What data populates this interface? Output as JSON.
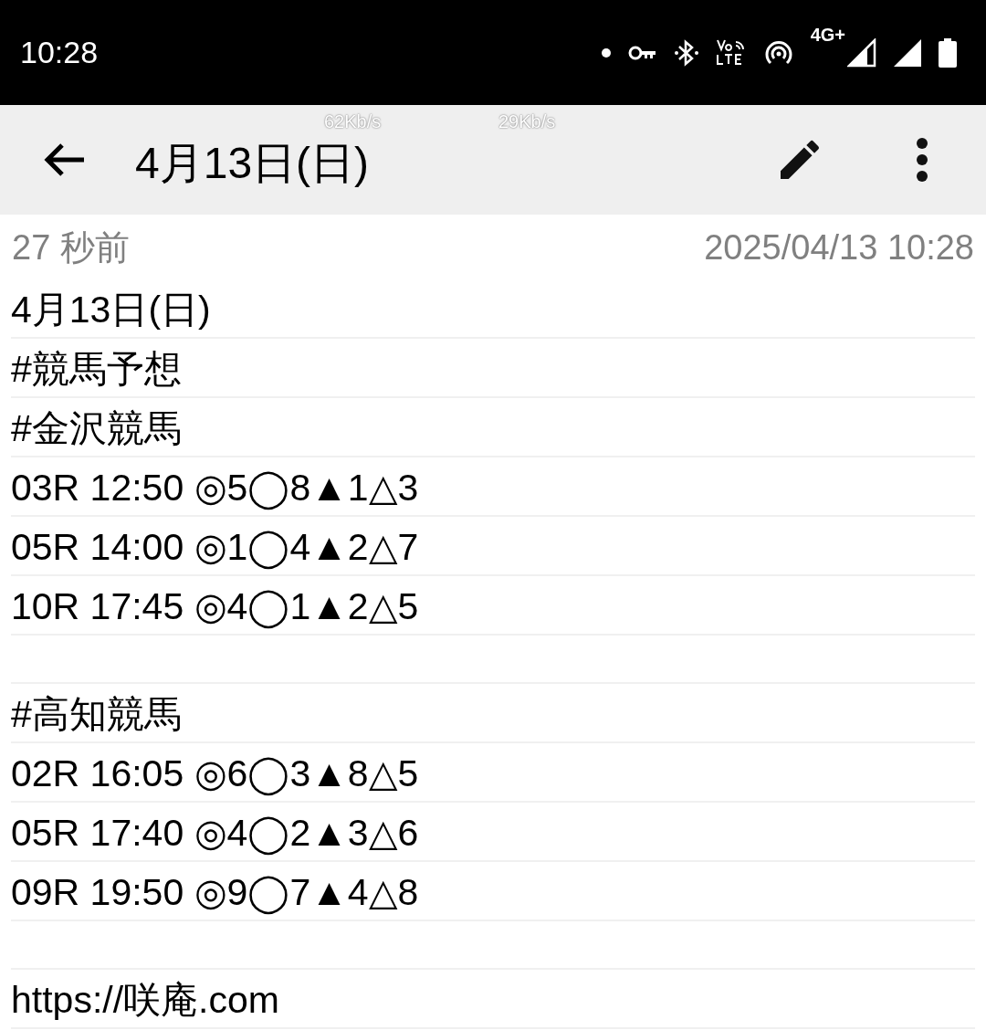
{
  "status_bar": {
    "time": "10:28",
    "network": "4G+"
  },
  "toolbar": {
    "title": "4月13日(日)",
    "speeds": [
      "62Kb/s",
      "29Kb/s"
    ]
  },
  "meta": {
    "relative_time": "27 秒前",
    "timestamp": "2025/04/13 10:28"
  },
  "lines": [
    {
      "kind": "text",
      "text": "4月13日(日)"
    },
    {
      "kind": "text",
      "text": "#競馬予想"
    },
    {
      "kind": "text",
      "text": "#金沢競馬"
    },
    {
      "kind": "text",
      "text": "03R 12:50 ◎5◯8▲1△3"
    },
    {
      "kind": "text",
      "text": "05R 14:00 ◎1◯4▲2△7"
    },
    {
      "kind": "text",
      "text": "10R 17:45 ◎4◯1▲2△5"
    },
    {
      "kind": "blank"
    },
    {
      "kind": "text",
      "text": "#高知競馬"
    },
    {
      "kind": "text",
      "text": "02R 16:05 ◎6◯3▲8△5"
    },
    {
      "kind": "text",
      "text": "05R 17:40 ◎4◯2▲3△6"
    },
    {
      "kind": "text",
      "text": "09R 19:50 ◎9◯7▲4△8"
    },
    {
      "kind": "blank"
    },
    {
      "kind": "text",
      "text": "https://咲庵.com"
    }
  ]
}
